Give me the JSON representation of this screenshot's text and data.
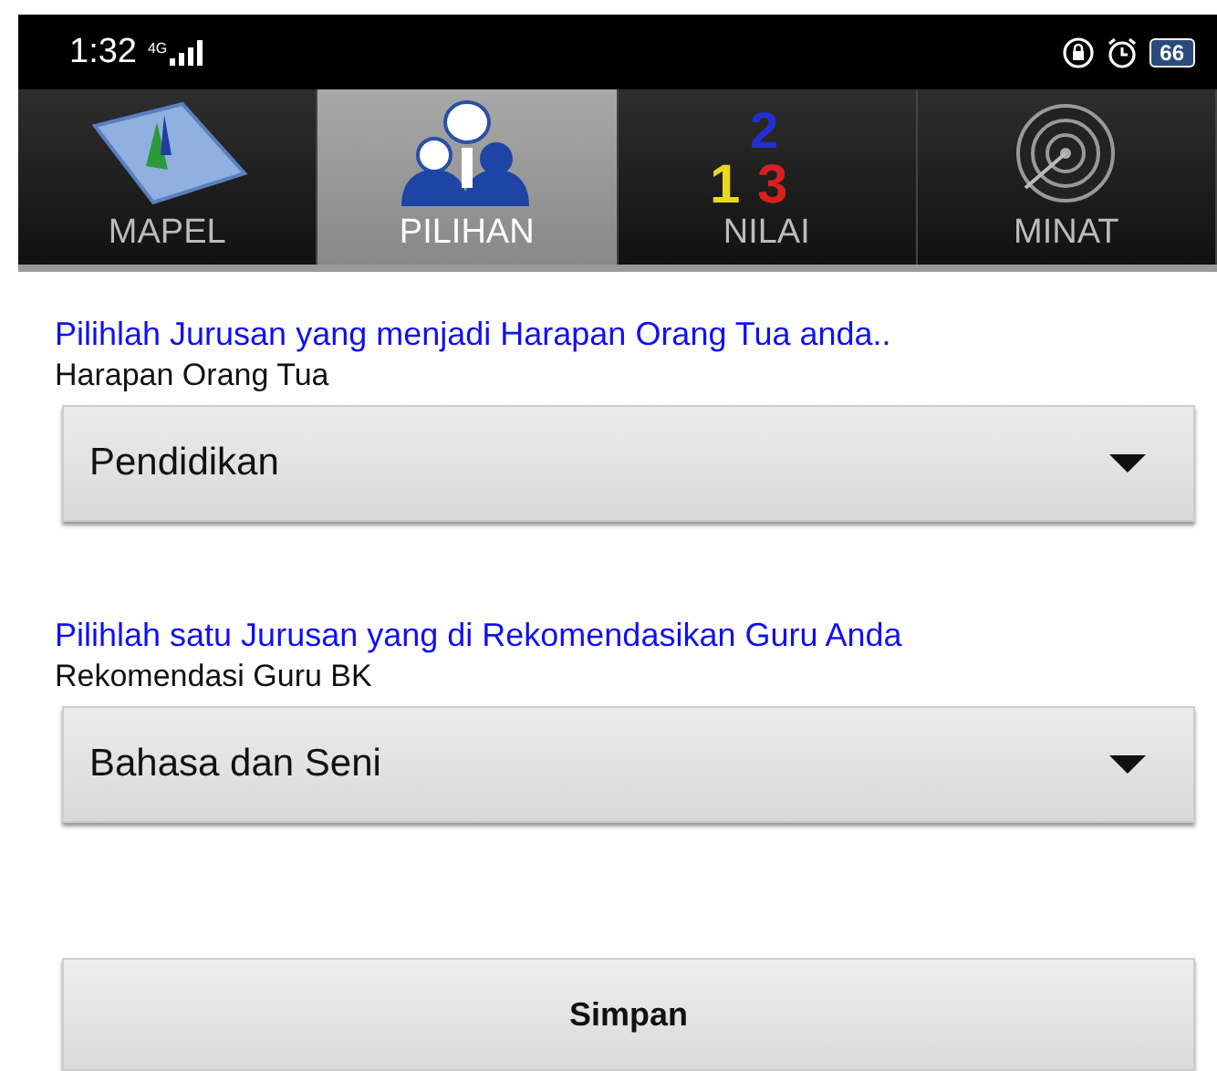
{
  "status_bar": {
    "time": "1:32",
    "network": "4G",
    "battery": "66"
  },
  "tabs": [
    {
      "label": "MAPEL",
      "kind": "book",
      "selected": false
    },
    {
      "label": "PILIHAN",
      "kind": "people",
      "selected": true
    },
    {
      "label": "NILAI",
      "kind": "numbers",
      "icon_digits": [
        "2",
        "1",
        "3"
      ],
      "selected": false
    },
    {
      "label": "MINAT",
      "kind": "target",
      "selected": false
    }
  ],
  "sections": [
    {
      "prompt": "Pilihlah Jurusan yang menjadi Harapan Orang Tua anda..",
      "label": "Harapan Orang Tua",
      "value": "Pendidikan"
    },
    {
      "prompt": "Pilihlah satu Jurusan yang di Rekomendasikan Guru Anda",
      "label": "Rekomendasi Guru BK",
      "value": "Bahasa dan Seni"
    }
  ],
  "save_button": "Simpan"
}
